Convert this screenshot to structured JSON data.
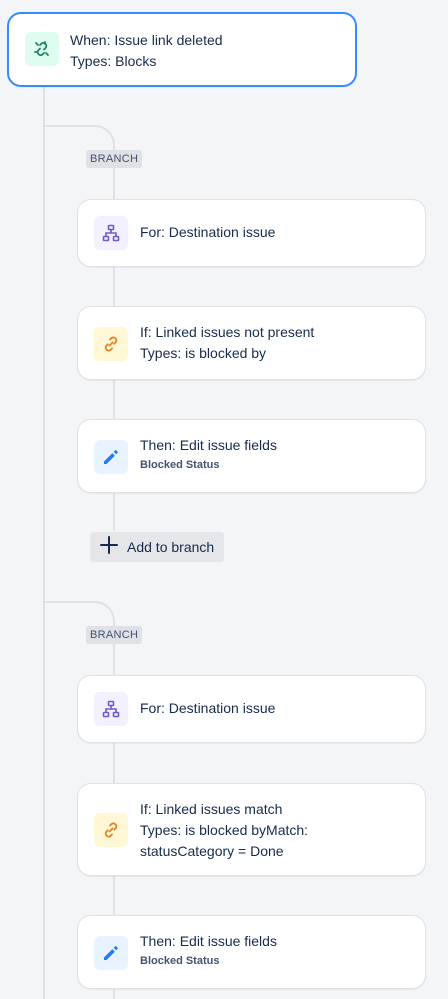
{
  "trigger": {
    "title": "When: Issue link deleted",
    "subtitle": "Types: Blocks",
    "icon": "link-broken-icon",
    "accent": "#388bff"
  },
  "branches": [
    {
      "tag": "BRANCH",
      "for": {
        "title": "For: Destination issue",
        "icon": "hierarchy-icon"
      },
      "condition": {
        "line1": "If: Linked issues not present",
        "line2": "Types: is blocked by",
        "icon": "link-icon"
      },
      "action": {
        "title": "Then: Edit issue fields",
        "detail": "Blocked Status",
        "icon": "pencil-icon"
      },
      "add_label": "Add to branch"
    },
    {
      "tag": "BRANCH",
      "for": {
        "title": "For: Destination issue",
        "icon": "hierarchy-icon"
      },
      "condition": {
        "line1": "If: Linked issues match",
        "line2": "Types: is blocked byMatch:",
        "line3": "statusCategory = Done",
        "icon": "link-icon"
      },
      "action": {
        "title": "Then: Edit issue fields",
        "detail": "Blocked Status",
        "icon": "pencil-icon"
      }
    }
  ],
  "colors": {
    "trigger_icon_bg": "#dffcf0",
    "trigger_icon": "#1f845a",
    "branch_icon_bg": "#f3f0ff",
    "branch_icon": "#6e5dc6",
    "condition_icon_bg": "#fff7d6",
    "condition_icon": "#e2801e",
    "action_icon_bg": "#e9f2ff",
    "action_icon": "#1d7afc"
  }
}
